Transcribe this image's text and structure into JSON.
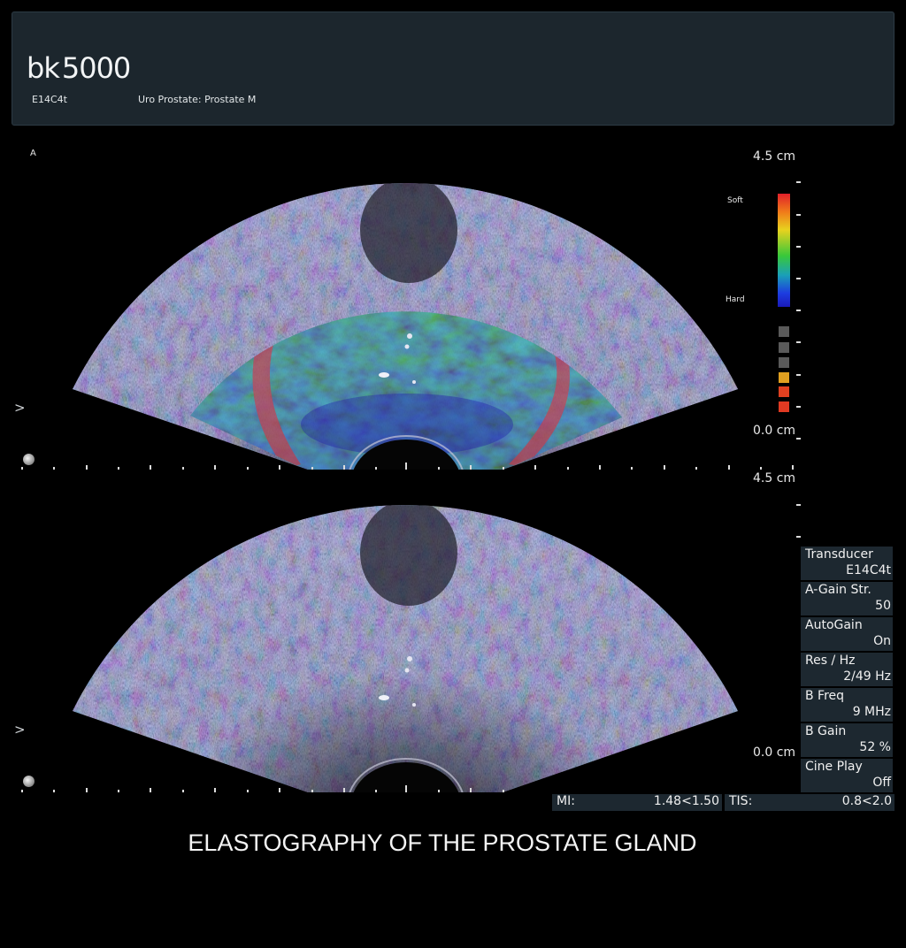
{
  "header": {
    "brand_prefix": "bk",
    "brand_model": "5000",
    "transducer": "E14C4t",
    "preset": "Uro Prostate: Prostate M"
  },
  "image_label": "A",
  "depth": {
    "top_max": "4.5 cm",
    "top_min": "0.0 cm",
    "bottom_max": "4.5 cm",
    "bottom_min": "0.0 cm"
  },
  "focus_marker": ">",
  "colorbar": {
    "soft_label": "Soft",
    "hard_label": "Hard",
    "gradient_colors": [
      "#e0202a",
      "#f07a1a",
      "#e8d21e",
      "#38c83a",
      "#1aa0b8",
      "#1d3ce0"
    ],
    "quality_swatches": [
      "#5a5a5a",
      "#5a5a5a",
      "#5a5a5a",
      "#e0a020",
      "#e04020",
      "#e03a22"
    ]
  },
  "parameters": [
    {
      "label": "Transducer",
      "value": "E14C4t"
    },
    {
      "label": "A-Gain Str.",
      "value": "50"
    },
    {
      "label": "AutoGain",
      "value": "On"
    },
    {
      "label": "Res / Hz",
      "value": "2/49 Hz"
    },
    {
      "label": "B Freq",
      "value": "9 MHz"
    },
    {
      "label": "B Gain",
      "value": "52 %"
    },
    {
      "label": "Cine Play",
      "value": "Off"
    }
  ],
  "indices": {
    "mi_label": "MI:",
    "mi_value": "1.48<1.50",
    "tis_label": "TIS:",
    "tis_value": "0.8<2.0"
  },
  "caption": "ELASTOGRAPHY OF THE PROSTATE GLAND"
}
